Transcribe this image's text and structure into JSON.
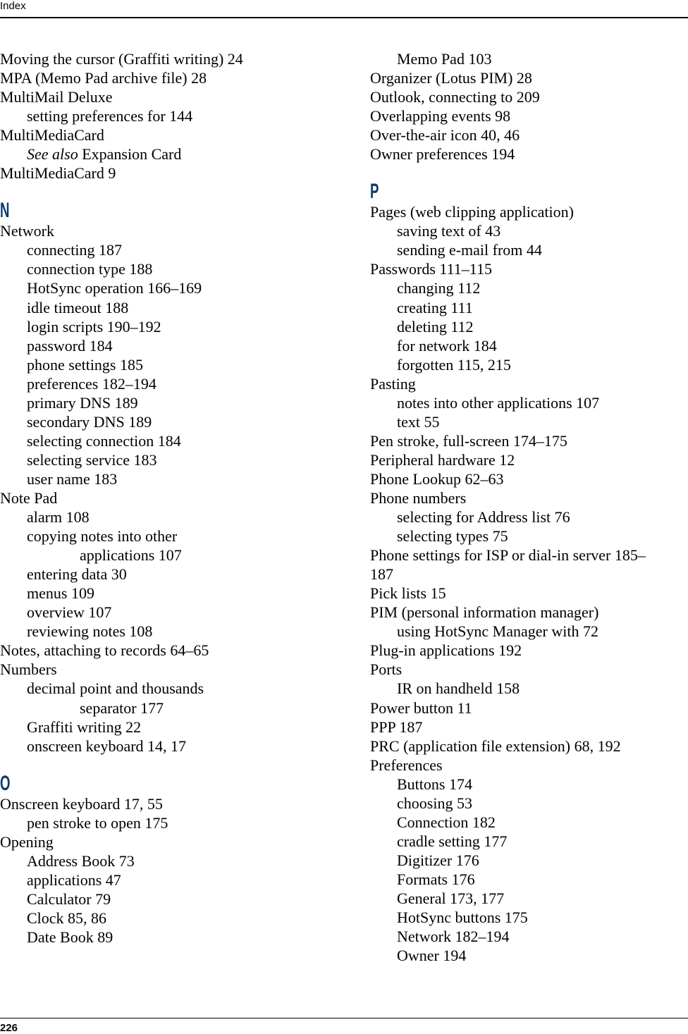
{
  "header": {
    "running_head": "Index"
  },
  "footer": {
    "page_number": "226"
  },
  "colors": {
    "section_letter": "#0e3a6e",
    "text": "#000000"
  },
  "left_column": [
    {
      "type": "entry",
      "level": 0,
      "text": "Moving the cursor (Graffiti writing)  24"
    },
    {
      "type": "entry",
      "level": 0,
      "text": "MPA (Memo Pad archive file)  28"
    },
    {
      "type": "entry",
      "level": 0,
      "text": "MultiMail Deluxe"
    },
    {
      "type": "entry",
      "level": 1,
      "text": "setting preferences for  144"
    },
    {
      "type": "entry",
      "level": 0,
      "text": "MultiMediaCard"
    },
    {
      "type": "see",
      "level": 1,
      "see": "See also",
      "text": " Expansion Card"
    },
    {
      "type": "entry",
      "level": 0,
      "text": "MultiMediaCard  9"
    },
    {
      "type": "letter",
      "text": "N"
    },
    {
      "type": "entry",
      "level": 0,
      "text": "Network"
    },
    {
      "type": "entry",
      "level": 1,
      "text": "connecting  187"
    },
    {
      "type": "entry",
      "level": 1,
      "text": "connection type  188"
    },
    {
      "type": "entry",
      "level": 1,
      "text": "HotSync operation  166–169"
    },
    {
      "type": "entry",
      "level": 1,
      "text": "idle timeout  188"
    },
    {
      "type": "entry",
      "level": 1,
      "text": "login scripts  190–192"
    },
    {
      "type": "entry",
      "level": 1,
      "text": "password  184"
    },
    {
      "type": "entry",
      "level": 1,
      "text": "phone settings  185"
    },
    {
      "type": "entry",
      "level": 1,
      "text": "preferences  182–194"
    },
    {
      "type": "entry",
      "level": 1,
      "text": "primary DNS  189"
    },
    {
      "type": "entry",
      "level": 1,
      "text": "secondary DNS  189"
    },
    {
      "type": "entry",
      "level": 1,
      "text": "selecting connection  184"
    },
    {
      "type": "entry",
      "level": 1,
      "text": "selecting service  183"
    },
    {
      "type": "entry",
      "level": 1,
      "text": "user name  183"
    },
    {
      "type": "entry",
      "level": 0,
      "text": "Note Pad"
    },
    {
      "type": "entry",
      "level": 1,
      "text": "alarm  108"
    },
    {
      "type": "entry",
      "level": 1,
      "text": "copying notes into other"
    },
    {
      "type": "entry",
      "level": 2,
      "text": "applications  107"
    },
    {
      "type": "entry",
      "level": 1,
      "text": "entering data  30"
    },
    {
      "type": "entry",
      "level": 1,
      "text": "menus  109"
    },
    {
      "type": "entry",
      "level": 1,
      "text": "overview  107"
    },
    {
      "type": "entry",
      "level": 1,
      "text": "reviewing notes  108"
    },
    {
      "type": "entry",
      "level": 0,
      "text": "Notes, attaching to records  64–65"
    },
    {
      "type": "entry",
      "level": 0,
      "text": "Numbers"
    },
    {
      "type": "entry",
      "level": 1,
      "text": "decimal point and thousands"
    },
    {
      "type": "entry",
      "level": 2,
      "text": "separator  177"
    },
    {
      "type": "entry",
      "level": 1,
      "text": "Graffiti writing  22"
    },
    {
      "type": "entry",
      "level": 1,
      "text": "onscreen keyboard  14, 17"
    },
    {
      "type": "letter",
      "text": "O"
    },
    {
      "type": "entry",
      "level": 0,
      "text": "Onscreen keyboard  17, 55"
    },
    {
      "type": "entry",
      "level": 1,
      "text": "pen stroke to open  175"
    },
    {
      "type": "entry",
      "level": 0,
      "text": "Opening"
    },
    {
      "type": "entry",
      "level": 1,
      "text": "Address Book  73"
    },
    {
      "type": "entry",
      "level": 1,
      "text": "applications  47"
    },
    {
      "type": "entry",
      "level": 1,
      "text": "Calculator  79"
    },
    {
      "type": "entry",
      "level": 1,
      "text": "Clock  85, 86"
    },
    {
      "type": "entry",
      "level": 1,
      "text": "Date Book  89"
    }
  ],
  "right_column": [
    {
      "type": "entry",
      "level": 1,
      "text": "Memo Pad  103"
    },
    {
      "type": "entry",
      "level": 0,
      "text": "Organizer (Lotus PIM)  28"
    },
    {
      "type": "entry",
      "level": 0,
      "text": "Outlook, connecting to  209"
    },
    {
      "type": "entry",
      "level": 0,
      "text": "Overlapping events  98"
    },
    {
      "type": "entry",
      "level": 0,
      "text": "Over-the-air icon  40, 46"
    },
    {
      "type": "entry",
      "level": 0,
      "text": "Owner preferences  194"
    },
    {
      "type": "letter",
      "text": "P"
    },
    {
      "type": "entry",
      "level": 0,
      "text": "Pages (web clipping application)"
    },
    {
      "type": "entry",
      "level": 1,
      "text": "saving text of  43"
    },
    {
      "type": "entry",
      "level": 1,
      "text": "sending e-mail from  44"
    },
    {
      "type": "entry",
      "level": 0,
      "text": "Passwords  111–115"
    },
    {
      "type": "entry",
      "level": 1,
      "text": "changing  112"
    },
    {
      "type": "entry",
      "level": 1,
      "text": "creating  111"
    },
    {
      "type": "entry",
      "level": 1,
      "text": "deleting  112"
    },
    {
      "type": "entry",
      "level": 1,
      "text": "for network  184"
    },
    {
      "type": "entry",
      "level": 1,
      "text": "forgotten  115, 215"
    },
    {
      "type": "entry",
      "level": 0,
      "text": "Pasting"
    },
    {
      "type": "entry",
      "level": 1,
      "text": "notes into other applications  107"
    },
    {
      "type": "entry",
      "level": 1,
      "text": "text  55"
    },
    {
      "type": "entry",
      "level": 0,
      "text": "Pen stroke, full-screen  174–175"
    },
    {
      "type": "entry",
      "level": 0,
      "text": "Peripheral hardware  12"
    },
    {
      "type": "entry",
      "level": 0,
      "text": "Phone Lookup  62–63"
    },
    {
      "type": "entry",
      "level": 0,
      "text": "Phone numbers"
    },
    {
      "type": "entry",
      "level": 1,
      "text": "selecting for Address list  76"
    },
    {
      "type": "entry",
      "level": 1,
      "text": "selecting types  75"
    },
    {
      "type": "entry",
      "level": 0,
      "text": "Phone settings for ISP or dial-in server  185–"
    },
    {
      "type": "entry",
      "level": 0,
      "text": "187"
    },
    {
      "type": "entry",
      "level": 0,
      "text": "Pick lists  15"
    },
    {
      "type": "entry",
      "level": 0,
      "text": "PIM (personal information manager)"
    },
    {
      "type": "entry",
      "level": 1,
      "text": "using HotSync Manager with  72"
    },
    {
      "type": "entry",
      "level": 0,
      "text": "Plug-in applications  192"
    },
    {
      "type": "entry",
      "level": 0,
      "text": "Ports"
    },
    {
      "type": "entry",
      "level": 1,
      "text": "IR on handheld  158"
    },
    {
      "type": "entry",
      "level": 0,
      "text": "Power button  11"
    },
    {
      "type": "entry",
      "level": 0,
      "text": "PPP  187"
    },
    {
      "type": "entry",
      "level": 0,
      "text": "PRC (application file extension)  68, 192"
    },
    {
      "type": "entry",
      "level": 0,
      "text": "Preferences"
    },
    {
      "type": "entry",
      "level": 1,
      "text": "Buttons  174"
    },
    {
      "type": "entry",
      "level": 1,
      "text": "choosing  53"
    },
    {
      "type": "entry",
      "level": 1,
      "text": "Connection  182"
    },
    {
      "type": "entry",
      "level": 1,
      "text": "cradle setting  177"
    },
    {
      "type": "entry",
      "level": 1,
      "text": "Digitizer  176"
    },
    {
      "type": "entry",
      "level": 1,
      "text": "Formats  176"
    },
    {
      "type": "entry",
      "level": 1,
      "text": "General  173, 177"
    },
    {
      "type": "entry",
      "level": 1,
      "text": "HotSync buttons  175"
    },
    {
      "type": "entry",
      "level": 1,
      "text": "Network  182–194"
    },
    {
      "type": "entry",
      "level": 1,
      "text": "Owner  194"
    }
  ]
}
